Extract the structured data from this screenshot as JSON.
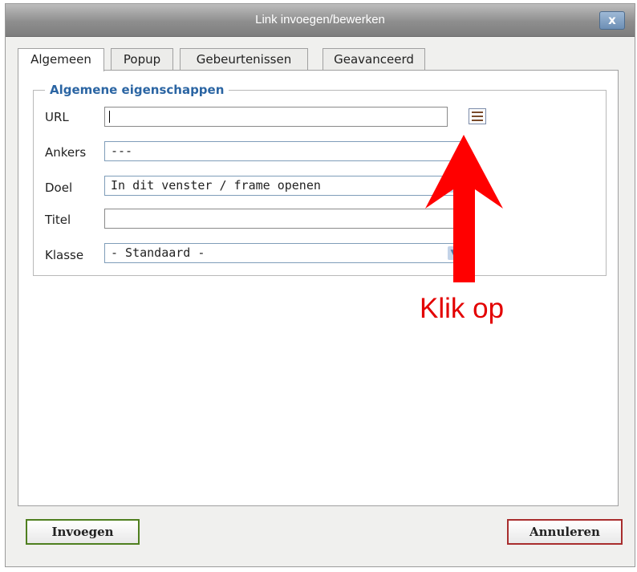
{
  "dialog": {
    "title": "Link invoegen/bewerken",
    "close_label": "x"
  },
  "tabs": [
    {
      "label": "Algemeen",
      "active": true
    },
    {
      "label": "Popup",
      "active": false
    },
    {
      "label": "Gebeurtenissen",
      "active": false
    },
    {
      "label": "Geavanceerd",
      "active": false
    }
  ],
  "section": {
    "legend": "Algemene eigenschappen"
  },
  "fields": {
    "url": {
      "label": "URL",
      "value": ""
    },
    "anchors": {
      "label": "Ankers",
      "value": "---"
    },
    "target": {
      "label": "Doel",
      "value": "In dit venster / frame openen"
    },
    "title": {
      "label": "Titel",
      "value": ""
    },
    "class": {
      "label": "Klasse",
      "value": "- Standaard -"
    }
  },
  "annotation": {
    "text": "Klik op",
    "color": "#e30000"
  },
  "buttons": {
    "insert": "Invoegen",
    "cancel": "Annuleren"
  },
  "icons": {
    "browse": "file-browser-icon",
    "close": "close-icon",
    "dropdown": "chevron-down-icon"
  }
}
